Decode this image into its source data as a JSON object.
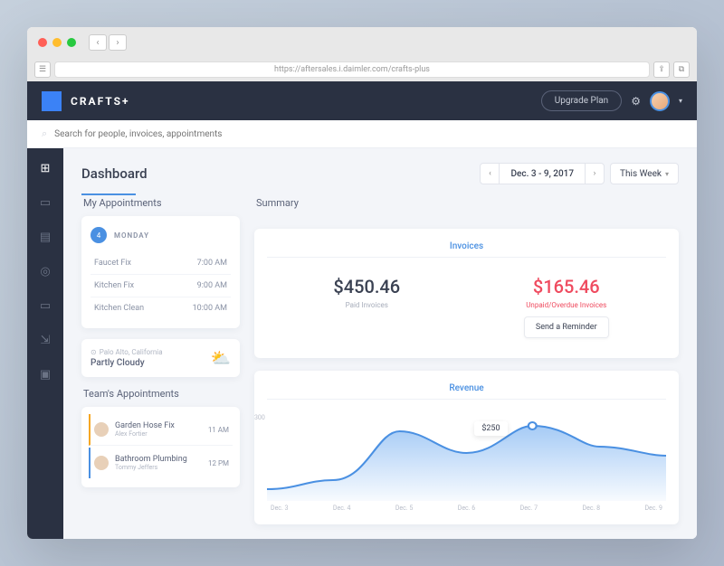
{
  "browser": {
    "url": "https://aftersales.i.daimler.com/crafts-plus"
  },
  "brand": "CRAFTS+",
  "topbar": {
    "upgrade": "Upgrade Plan"
  },
  "search": {
    "placeholder": "Search for people, invoices, appointments"
  },
  "page": {
    "title": "Dashboard",
    "daterange": "Dec. 3 - 9, 2017",
    "preset": "This Week"
  },
  "my_appointments": {
    "title": "My Appointments",
    "day_num": "4",
    "day_name": "MONDAY",
    "items": [
      {
        "title": "Faucet Fix",
        "time": "7:00 AM"
      },
      {
        "title": "Kitchen Fix",
        "time": "9:00 AM"
      },
      {
        "title": "Kitchen Clean",
        "time": "10:00 AM"
      }
    ]
  },
  "weather": {
    "location": "Palo Alto, California",
    "condition": "Partly Cloudy"
  },
  "team_appointments": {
    "title": "Team's Appointments",
    "items": [
      {
        "title": "Garden Hose Fix",
        "person": "Alex Fortier",
        "time": "11 AM"
      },
      {
        "title": "Bathroom Plumbing",
        "person": "Tommy Jeffers",
        "time": "12 PM"
      }
    ]
  },
  "summary": {
    "title": "Summary",
    "invoices": {
      "header": "Invoices",
      "paid_amount": "$450.46",
      "paid_label": "Paid Invoices",
      "unpaid_amount": "$165.46",
      "unpaid_label": "Unpaid/Overdue Invoices",
      "reminder_btn": "Send a Reminder"
    },
    "revenue": {
      "header": "Revenue",
      "tooltip": "$250",
      "y_max": "300"
    }
  },
  "chart_data": {
    "type": "area",
    "title": "Revenue",
    "ylabel": "",
    "ylim": [
      0,
      300
    ],
    "categories": [
      "Dec. 3",
      "Dec. 4",
      "Dec. 5",
      "Dec. 6",
      "Dec. 7",
      "Dec. 8",
      "Dec. 9"
    ],
    "values": [
      40,
      70,
      230,
      160,
      250,
      180,
      150
    ],
    "highlight": {
      "index": 4,
      "value": 250
    }
  }
}
